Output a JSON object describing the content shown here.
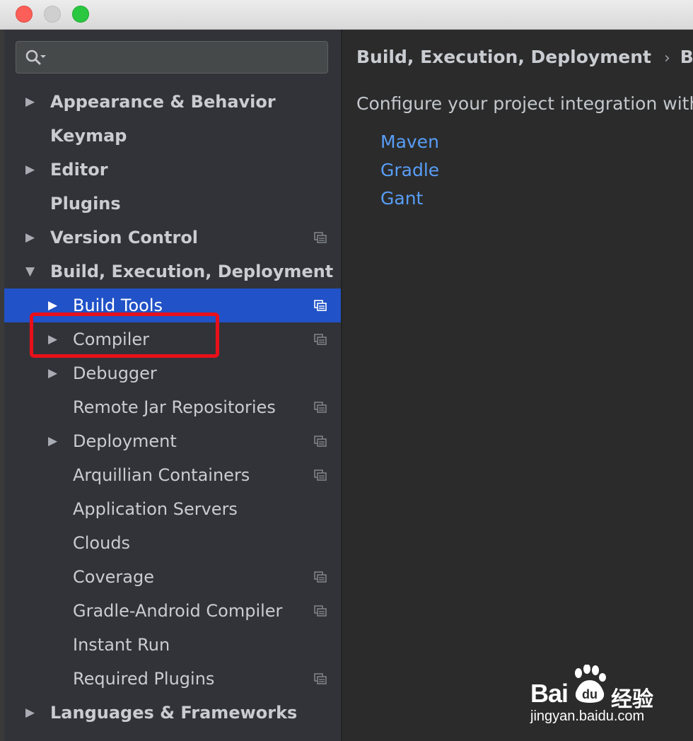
{
  "search": {
    "placeholder": ""
  },
  "sidebar": {
    "items": [
      {
        "label": "Appearance & Behavior",
        "bold": true,
        "arrow": "right",
        "level": 0,
        "project_icon": false,
        "selected": false
      },
      {
        "label": "Keymap",
        "bold": true,
        "arrow": "none",
        "level": 0,
        "project_icon": false,
        "selected": false
      },
      {
        "label": "Editor",
        "bold": true,
        "arrow": "right",
        "level": 0,
        "project_icon": false,
        "selected": false
      },
      {
        "label": "Plugins",
        "bold": true,
        "arrow": "none",
        "level": 0,
        "project_icon": false,
        "selected": false
      },
      {
        "label": "Version Control",
        "bold": true,
        "arrow": "right",
        "level": 0,
        "project_icon": true,
        "selected": false
      },
      {
        "label": "Build, Execution, Deployment",
        "bold": true,
        "arrow": "down",
        "level": 0,
        "project_icon": false,
        "selected": false
      },
      {
        "label": "Build Tools",
        "bold": false,
        "arrow": "right",
        "level": 1,
        "project_icon": true,
        "selected": true
      },
      {
        "label": "Compiler",
        "bold": false,
        "arrow": "right",
        "level": 1,
        "project_icon": true,
        "selected": false
      },
      {
        "label": "Debugger",
        "bold": false,
        "arrow": "right",
        "level": 1,
        "project_icon": false,
        "selected": false
      },
      {
        "label": "Remote Jar Repositories",
        "bold": false,
        "arrow": "none",
        "level": 1,
        "project_icon": true,
        "selected": false
      },
      {
        "label": "Deployment",
        "bold": false,
        "arrow": "right",
        "level": 1,
        "project_icon": true,
        "selected": false
      },
      {
        "label": "Arquillian Containers",
        "bold": false,
        "arrow": "none",
        "level": 1,
        "project_icon": true,
        "selected": false
      },
      {
        "label": "Application Servers",
        "bold": false,
        "arrow": "none",
        "level": 1,
        "project_icon": false,
        "selected": false
      },
      {
        "label": "Clouds",
        "bold": false,
        "arrow": "none",
        "level": 1,
        "project_icon": false,
        "selected": false
      },
      {
        "label": "Coverage",
        "bold": false,
        "arrow": "none",
        "level": 1,
        "project_icon": true,
        "selected": false
      },
      {
        "label": "Gradle-Android Compiler",
        "bold": false,
        "arrow": "none",
        "level": 1,
        "project_icon": true,
        "selected": false
      },
      {
        "label": "Instant Run",
        "bold": false,
        "arrow": "none",
        "level": 1,
        "project_icon": false,
        "selected": false
      },
      {
        "label": "Required Plugins",
        "bold": false,
        "arrow": "none",
        "level": 1,
        "project_icon": true,
        "selected": false
      },
      {
        "label": "Languages & Frameworks",
        "bold": true,
        "arrow": "right",
        "level": 0,
        "project_icon": false,
        "selected": false
      }
    ]
  },
  "content": {
    "breadcrumb": {
      "parent": "Build, Execution, Deployment",
      "separator": "›",
      "current": "Buil"
    },
    "description": "Configure your project integration with",
    "links": [
      "Maven",
      "Gradle",
      "Gant"
    ]
  },
  "watermark": {
    "brand": "Bai",
    "brand_suffix": "du",
    "cn": "经验",
    "url": "jingyan.baidu.com"
  },
  "colors": {
    "selection": "#2152c7",
    "link": "#589df6",
    "highlight_box": "#e8101a",
    "sidebar_bg": "#313338",
    "content_bg": "#2b2b2b"
  }
}
